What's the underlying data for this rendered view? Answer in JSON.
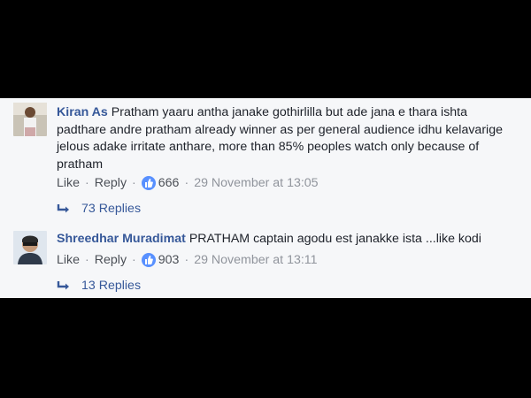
{
  "comments": [
    {
      "author": "Kiran As",
      "text": "Pratham yaaru antha janake gothirlilla but ade jana e thara ishta padthare andre pratham already winner as per general audience idhu kelavarige jelous adake irritate anthare, more than 85% peoples watch only because of pratham",
      "like_label": "Like",
      "reply_label": "Reply",
      "like_count": "666",
      "timestamp": "29 November at 13:05",
      "replies_label": "73 Replies"
    },
    {
      "author": "Shreedhar Muradimat",
      "text": "PRATHAM captain agodu est janakke ista ...like kodi",
      "like_label": "Like",
      "reply_label": "Reply",
      "like_count": "903",
      "timestamp": "29 November at 13:11",
      "replies_label": "13 Replies"
    }
  ],
  "separator": "·",
  "icons": {
    "reaction": "thumbs-up-icon",
    "replies": "reply-arrow-icon"
  },
  "colors": {
    "author": "#365899",
    "reaction_badge": "#5890ff",
    "panel_background": "#f6f7f9",
    "letterbox": "#000000"
  }
}
